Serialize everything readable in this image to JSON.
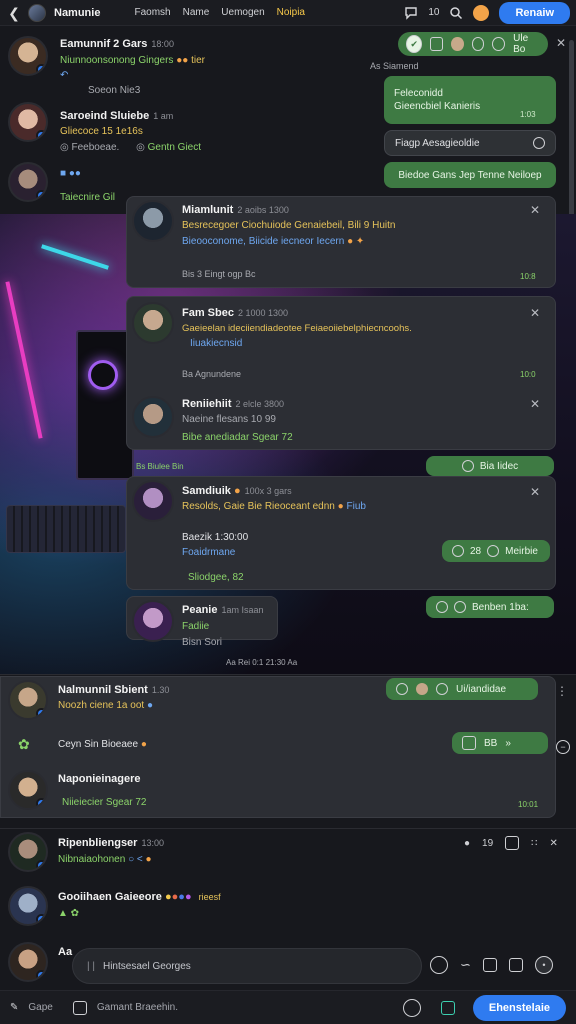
{
  "topbar": {
    "title": "Namunie",
    "nav": [
      "Faomsh",
      "Name",
      "Uemogen",
      "Noipia"
    ],
    "count": "10",
    "action_button": "Renaiw"
  },
  "messages": [
    {
      "name": "Eamunnif 2 Gars",
      "meta": "18:00",
      "line1": "Niunnoonsonong Gingers",
      "line2": "Soeon Nie3",
      "extra": "tier"
    },
    {
      "name": "Saroeind Sluiebe",
      "meta": "1 am",
      "line1": "Gliecoce 15 1e16s",
      "line2": "Feeboeae.",
      "line3": "Gentn Giect"
    },
    {
      "name": "",
      "line1": "Taiecnire Gil"
    }
  ],
  "right_bubbles": {
    "header_label": "As Siamend",
    "top_pill": "Ule Bo",
    "green1_line1": "Feleconidd",
    "green1_line2": "Gieencbiel Kanieris",
    "green1_time": "1:03",
    "dark1": "Fiagp Aesagieoldie",
    "green2": "Biedoe Gans Jep Tenne Neiloep"
  },
  "thread": [
    {
      "name": "Miamlunit",
      "meta": "2 aoibs 1300",
      "line1": "Besrecegoer Ciochuiode Genaiebeil, Bili 9 Huitn",
      "line2": "Bieooconome, Biicide iecneor Iecern",
      "footer": "Bis 3 Eingt ogp Bc",
      "time": "10:8"
    },
    {
      "name": "Fam Sbec",
      "meta": "2 1000 1300",
      "line1": "Gaeieelan ideciiendiadeotee Feiaeoiiebelphiecncoohs.",
      "line2": "Iiuakiecnsid",
      "footer": "Ba Agnundene",
      "time": "10:0"
    },
    {
      "name": "Reniiehiit",
      "meta": "2 elcle 3800",
      "line1": "Naeine flesans  10 99",
      "line2": "Bibe anediadar Sgear 72"
    },
    {
      "name": "Samdiuik",
      "meta": "100x 3 gars",
      "line1": "Resolds, Gaie Bie Rieoceant ednn",
      "line2": "Fiub",
      "line3": "Baezik  1:30:00",
      "line4": "Foaidrmane",
      "line5": "Sliodgee, 82"
    },
    {
      "name": "Peanie",
      "meta": "1am Isaan",
      "line1": "Fadiie",
      "line2": "Bisn Sori"
    }
  ],
  "thread_pills": {
    "p1": "Bia Iidec",
    "p2_num": "28",
    "p2": "Meirbie",
    "p3": "Benben 1ba:",
    "tag_left": "Bs Biulee Bin",
    "footer_row": "Aa Rei 0:1 21:30 Aa"
  },
  "lower": [
    {
      "name": "Nalmunnil Sbient",
      "meta": "1.30",
      "line1": "Noozh ciene 1a oot",
      "line2": "Ceyn Sin Bioeaee"
    },
    {
      "name": "Naponieinagere",
      "line1": "Niieiecier Sgear 72",
      "time": "10:01"
    },
    {
      "name": "Ripenbliengser",
      "meta": "13:00",
      "line1": "Nibnaiaohonen",
      "num": "19"
    },
    {
      "name": "Gooiihaen Gaieeore",
      "line1": "rieesf"
    },
    {
      "name": "Aa",
      "line1": ""
    }
  ],
  "lower_pills": {
    "l1": "Ui/iandidae",
    "l2": "BB"
  },
  "composer": {
    "placeholder": "Hintsesael Georges"
  },
  "bottombar": {
    "left1": "Gape",
    "left2": "Gamant Braeehin.",
    "send": "Ehenstelaie"
  }
}
